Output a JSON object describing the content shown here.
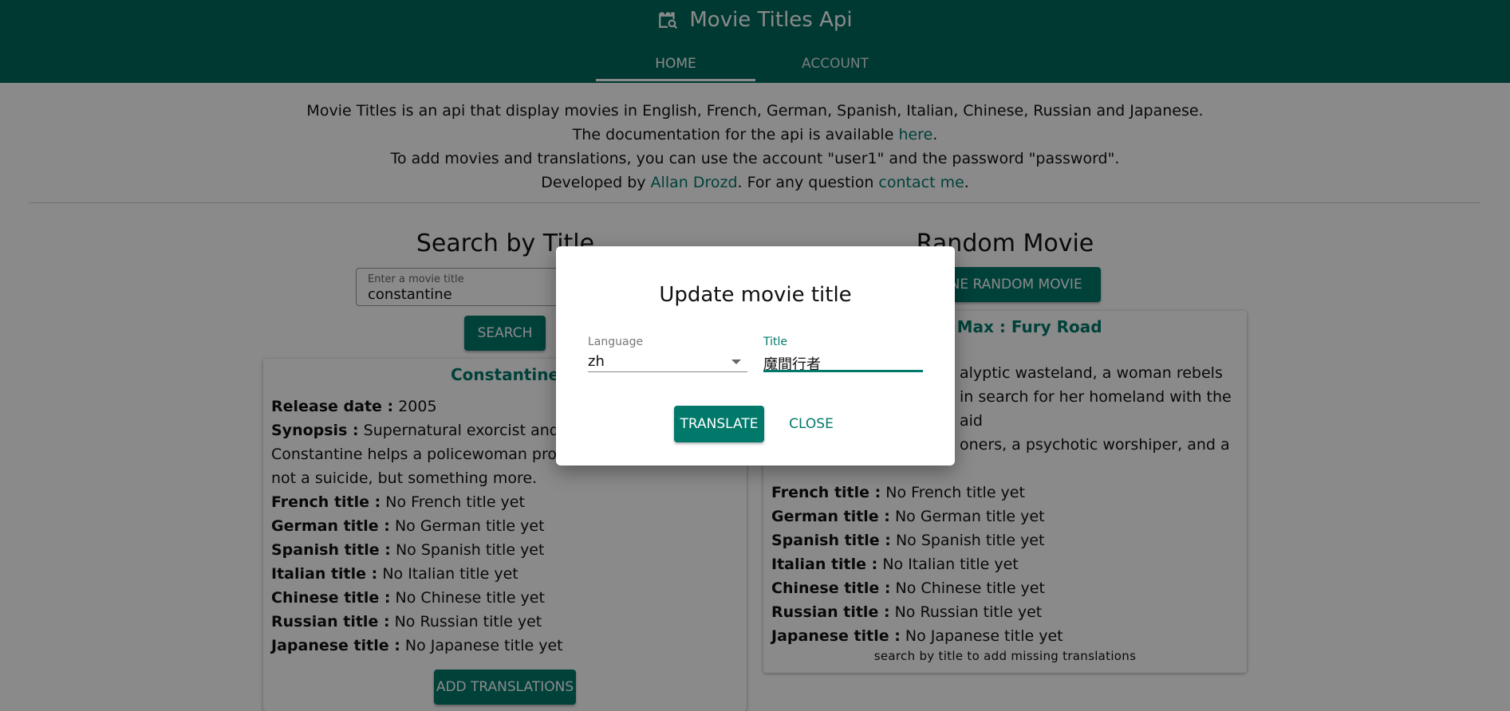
{
  "header": {
    "title": "Movie Titles Api",
    "logo_icon": "movie-search-icon",
    "tabs": [
      {
        "label": "HOME",
        "active": true
      },
      {
        "label": "ACCOUNT",
        "active": false
      }
    ]
  },
  "intro": {
    "line1": "Movie Titles is an api that display movies in English, French, German, Spanish, Italian, Chinese, Russian and Japanese.",
    "line2_prefix": "The documentation for the api is available ",
    "line2_link": "here",
    "line2_suffix": ".",
    "line3": "To add movies and translations, you can use the account \"user1\" and the password \"password\".",
    "line4_prefix": "Developed by ",
    "line4_author": "Allan Drozd",
    "line4_mid": ". For any question ",
    "line4_contact": "contact me",
    "line4_suffix": "."
  },
  "search": {
    "title": "Search by Title",
    "field_label": "Enter a movie title",
    "field_value": "constantine",
    "button": "SEARCH"
  },
  "search_result": {
    "movie_title": "Constantine",
    "release_label": "Release date :",
    "release_value": "2005",
    "synopsis_label": "Synopsis :",
    "synopsis_line1": "Supernatural exorcist and de",
    "synopsis_line2": "Constantine helps a policewoman prove",
    "synopsis_line3": "not a suicide, but something more.",
    "titles": [
      {
        "label": "French title :",
        "value": "No French title yet"
      },
      {
        "label": "German title :",
        "value": "No German title yet"
      },
      {
        "label": "Spanish title :",
        "value": "No Spanish title yet"
      },
      {
        "label": "Italian title :",
        "value": "No Italian title yet"
      },
      {
        "label": "Chinese title :",
        "value": "No Chinese title yet"
      },
      {
        "label": "Russian title :",
        "value": "No Russian title yet"
      },
      {
        "label": "Japanese title :",
        "value": "No Japanese title yet"
      }
    ],
    "button": "ADD TRANSLATIONS"
  },
  "random": {
    "title": "Random Movie",
    "button": "ONE RANDOM MOVIE",
    "movie_title": "d Max : Fury Road",
    "synopsis_line1": "alyptic wasteland, a woman rebels",
    "synopsis_line2": "in search for her homeland with the aid",
    "synopsis_line3": "oners, a psychotic worshiper, and a",
    "titles": [
      {
        "label": "French title :",
        "value": "No French title yet"
      },
      {
        "label": "German title :",
        "value": "No German title yet"
      },
      {
        "label": "Spanish title :",
        "value": "No Spanish title yet"
      },
      {
        "label": "Italian title :",
        "value": "No Italian title yet"
      },
      {
        "label": "Chinese title :",
        "value": "No Chinese title yet"
      },
      {
        "label": "Russian title :",
        "value": "No Russian title yet"
      },
      {
        "label": "Japanese title :",
        "value": "No Japanese title yet"
      }
    ],
    "footer": "search by title to add missing translations"
  },
  "dialog": {
    "title": "Update movie title",
    "language_label": "Language",
    "language_value": "zh",
    "title_label": "Title",
    "title_value": "魔間行者",
    "translate_button": "TRANSLATE",
    "close_button": "CLOSE"
  },
  "colors": {
    "primary": "#00695c",
    "accent": "#00796b",
    "scrim": "rgba(0,0,0,0.46)"
  }
}
